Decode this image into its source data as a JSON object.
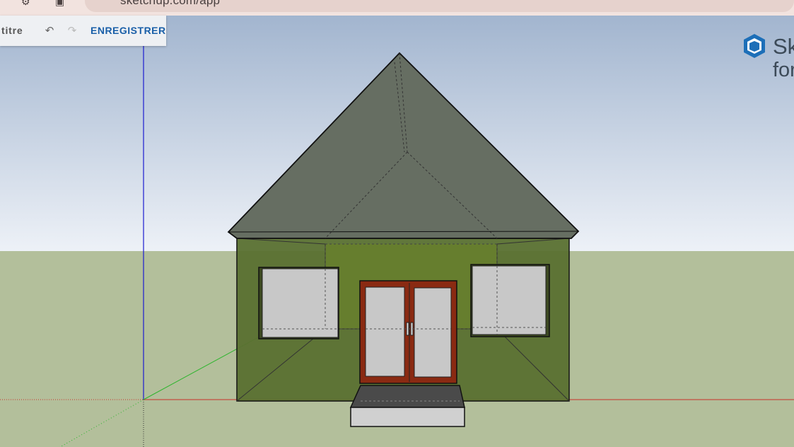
{
  "browser": {
    "url": "sketchup.com/app"
  },
  "toolbar": {
    "title_fragment": "titre",
    "undo_icon": "undo-icon",
    "redo_icon": "redo-icon",
    "save_label": "ENREGISTRER"
  },
  "branding": {
    "logo_icon": "sketchup-logo-icon",
    "text_line_1": "Sk",
    "text_line_2": "for"
  },
  "colors": {
    "sky_top": "#a3b6d0",
    "sky_bottom": "#e9eef5",
    "ground": "#b3bf9b",
    "wall": "#5a7030",
    "roof": "#666e62",
    "door_frame": "#8a2a12",
    "glass": "#c8c8c8",
    "axis_red": "#c8322a",
    "axis_green": "#2db52d",
    "axis_blue": "#1c1cd0",
    "accent": "#1a5fa8"
  }
}
